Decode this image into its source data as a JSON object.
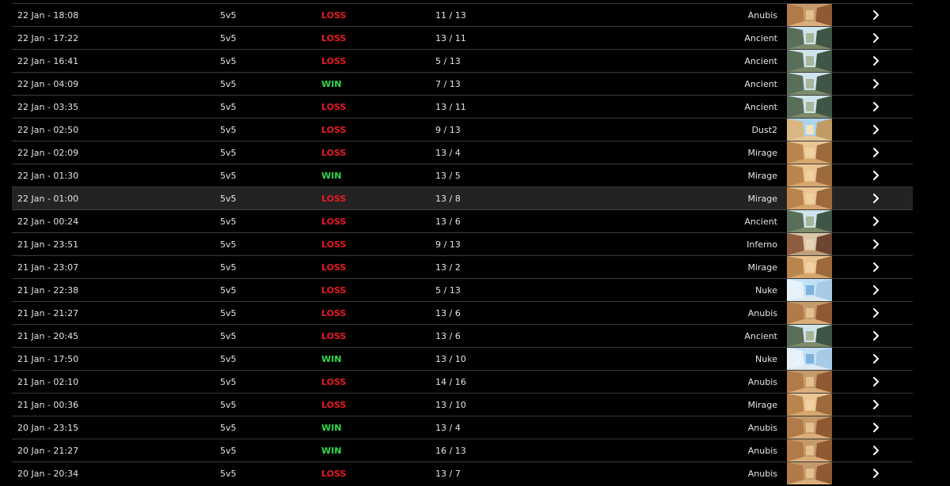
{
  "colors": {
    "loss": "#e81a25",
    "win": "#2ed84a",
    "row_border": "#3a3a3a",
    "hover_bg": "#232323"
  },
  "maps": {
    "Anubis": {
      "sky": "#c49a6c",
      "left": "#b27a48",
      "right": "#8f5a33",
      "floor": "#d9ae7a",
      "accent": "#e2c08f"
    },
    "Ancient": {
      "sky": "#cfe3ea",
      "left": "#5a6f5a",
      "right": "#3f5645",
      "floor": "#7d8b6c",
      "accent": "#a7b59a"
    },
    "Dust2": {
      "sky": "#a9d3ef",
      "left": "#d8b783",
      "right": "#c29a63",
      "floor": "#e3c99d",
      "accent": "#f2e3c4"
    },
    "Mirage": {
      "sky": "#e8c592",
      "left": "#b9854d",
      "right": "#9c6a3b",
      "floor": "#d7a66a",
      "accent": "#f0d2a1"
    },
    "Inferno": {
      "sky": "#d9c6a6",
      "left": "#8c5d3e",
      "right": "#6e4530",
      "floor": "#bfa07a",
      "accent": "#e6d5b6"
    },
    "Nuke": {
      "sky": "#bfe0f7",
      "left": "#e8f2fa",
      "right": "#a7cbe6",
      "floor": "#dfe9f2",
      "accent": "#7fb2dc"
    }
  },
  "matches": [
    {
      "date": "22 Jan - 18:08",
      "mode": "5v5",
      "result": "LOSS",
      "score": "11 / 13",
      "map": "Anubis",
      "map_thumb": "anubis-map-thumbnail"
    },
    {
      "date": "22 Jan - 17:22",
      "mode": "5v5",
      "result": "LOSS",
      "score": "13 / 11",
      "map": "Ancient",
      "map_thumb": "ancient-map-thumbnail"
    },
    {
      "date": "22 Jan - 16:41",
      "mode": "5v5",
      "result": "LOSS",
      "score": "5 / 13",
      "map": "Ancient",
      "map_thumb": "ancient-map-thumbnail"
    },
    {
      "date": "22 Jan - 04:09",
      "mode": "5v5",
      "result": "WIN",
      "score": "7 / 13",
      "map": "Ancient",
      "map_thumb": "ancient-map-thumbnail"
    },
    {
      "date": "22 Jan - 03:35",
      "mode": "5v5",
      "result": "LOSS",
      "score": "13 / 11",
      "map": "Ancient",
      "map_thumb": "ancient-map-thumbnail"
    },
    {
      "date": "22 Jan - 02:50",
      "mode": "5v5",
      "result": "LOSS",
      "score": "9 / 13",
      "map": "Dust2",
      "map_thumb": "dust2-map-thumbnail"
    },
    {
      "date": "22 Jan - 02:09",
      "mode": "5v5",
      "result": "LOSS",
      "score": "13 / 4",
      "map": "Mirage",
      "map_thumb": "mirage-map-thumbnail"
    },
    {
      "date": "22 Jan - 01:30",
      "mode": "5v5",
      "result": "WIN",
      "score": "13 / 5",
      "map": "Mirage",
      "map_thumb": "mirage-map-thumbnail"
    },
    {
      "date": "22 Jan - 01:00",
      "mode": "5v5",
      "result": "LOSS",
      "score": "13 / 8",
      "map": "Mirage",
      "map_thumb": "mirage-map-thumbnail",
      "hover": true
    },
    {
      "date": "22 Jan - 00:24",
      "mode": "5v5",
      "result": "LOSS",
      "score": "13 / 6",
      "map": "Ancient",
      "map_thumb": "ancient-map-thumbnail"
    },
    {
      "date": "21 Jan - 23:51",
      "mode": "5v5",
      "result": "LOSS",
      "score": "9 / 13",
      "map": "Inferno",
      "map_thumb": "inferno-map-thumbnail"
    },
    {
      "date": "21 Jan - 23:07",
      "mode": "5v5",
      "result": "LOSS",
      "score": "13 / 2",
      "map": "Mirage",
      "map_thumb": "mirage-map-thumbnail"
    },
    {
      "date": "21 Jan - 22:38",
      "mode": "5v5",
      "result": "LOSS",
      "score": "5 / 13",
      "map": "Nuke",
      "map_thumb": "nuke-map-thumbnail"
    },
    {
      "date": "21 Jan - 21:27",
      "mode": "5v5",
      "result": "LOSS",
      "score": "13 / 6",
      "map": "Anubis",
      "map_thumb": "anubis-map-thumbnail"
    },
    {
      "date": "21 Jan - 20:45",
      "mode": "5v5",
      "result": "LOSS",
      "score": "13 / 6",
      "map": "Ancient",
      "map_thumb": "ancient-map-thumbnail"
    },
    {
      "date": "21 Jan - 17:50",
      "mode": "5v5",
      "result": "WIN",
      "score": "13 / 10",
      "map": "Nuke",
      "map_thumb": "nuke-map-thumbnail"
    },
    {
      "date": "21 Jan - 02:10",
      "mode": "5v5",
      "result": "LOSS",
      "score": "14 / 16",
      "map": "Anubis",
      "map_thumb": "anubis-map-thumbnail"
    },
    {
      "date": "21 Jan - 00:36",
      "mode": "5v5",
      "result": "LOSS",
      "score": "13 / 10",
      "map": "Mirage",
      "map_thumb": "mirage-map-thumbnail"
    },
    {
      "date": "20 Jan - 23:15",
      "mode": "5v5",
      "result": "WIN",
      "score": "13 / 4",
      "map": "Anubis",
      "map_thumb": "anubis-map-thumbnail"
    },
    {
      "date": "20 Jan - 21:27",
      "mode": "5v5",
      "result": "WIN",
      "score": "16 / 13",
      "map": "Anubis",
      "map_thumb": "anubis-map-thumbnail"
    },
    {
      "date": "20 Jan - 20:34",
      "mode": "5v5",
      "result": "LOSS",
      "score": "13 / 7",
      "map": "Anubis",
      "map_thumb": "anubis-map-thumbnail"
    }
  ],
  "row_action_icon": "chevron-right-icon"
}
